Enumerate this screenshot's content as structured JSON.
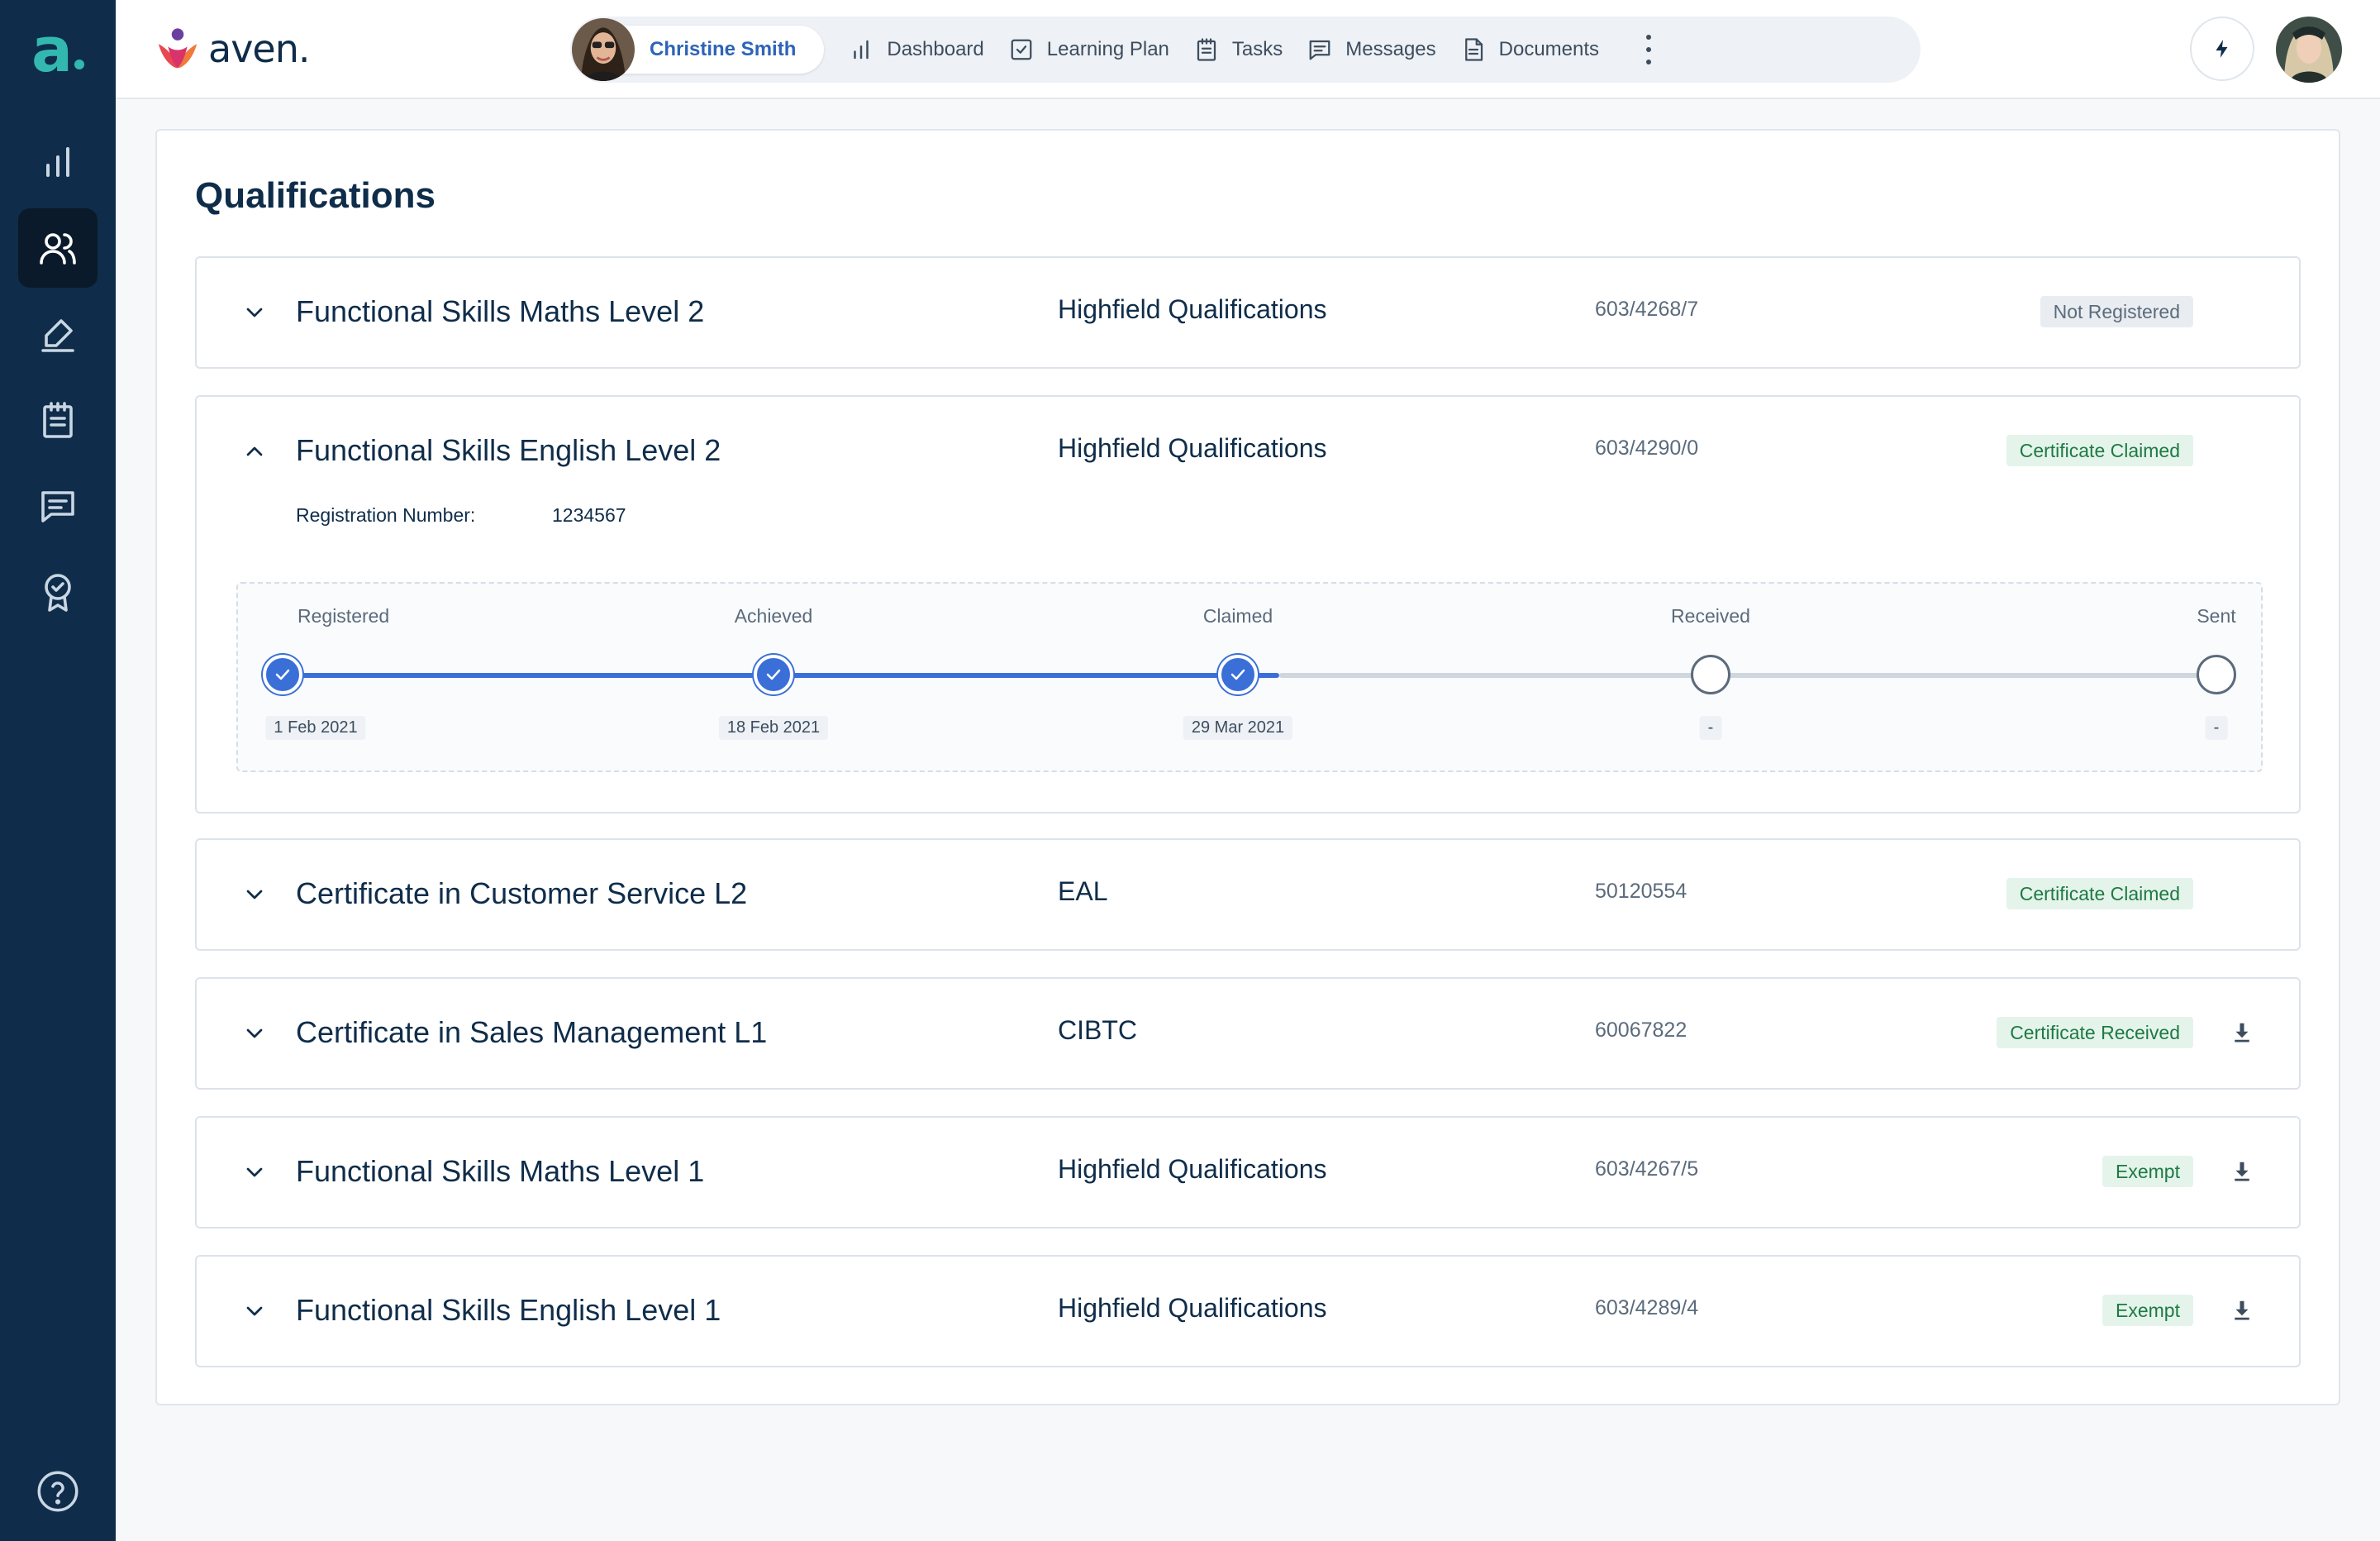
{
  "brand": {
    "name": "aven.",
    "sidebar_logo": "a"
  },
  "sidebar": {
    "items": [
      {
        "icon": "bar-chart-icon",
        "active": false
      },
      {
        "icon": "users-icon",
        "active": true
      },
      {
        "icon": "pen-signature-icon",
        "active": false
      },
      {
        "icon": "clipboard-icon",
        "active": false
      },
      {
        "icon": "chat-icon",
        "active": false
      },
      {
        "icon": "award-icon",
        "active": false
      }
    ],
    "help_icon": "help-circle-icon"
  },
  "header": {
    "user_name": "Christine Smith",
    "nav": [
      {
        "label": "Dashboard",
        "icon": "bar-chart-icon"
      },
      {
        "label": "Learning Plan",
        "icon": "checkbox-icon"
      },
      {
        "label": "Tasks",
        "icon": "clipboard-icon"
      },
      {
        "label": "Messages",
        "icon": "chat-icon"
      },
      {
        "label": "Documents",
        "icon": "document-icon"
      }
    ],
    "more_icon": "more-vertical-icon",
    "action_icon": "lightning-icon"
  },
  "page": {
    "title": "Qualifications",
    "qualifications": [
      {
        "name": "Functional Skills Maths Level 2",
        "org": "Highfield Qualifications",
        "code": "603/4268/7",
        "status": "Not Registered",
        "status_tone": "grey",
        "expanded": false,
        "download": false
      },
      {
        "name": "Functional Skills English Level 2",
        "org": "Highfield Qualifications",
        "code": "603/4290/0",
        "status": "Certificate Claimed",
        "status_tone": "green",
        "expanded": true,
        "download": false
      },
      {
        "name": "Certificate in Customer Service L2",
        "org": "EAL",
        "code": "50120554",
        "status": "Certificate Claimed",
        "status_tone": "green",
        "expanded": false,
        "download": false
      },
      {
        "name": "Certificate in Sales Management L1",
        "org": "CIBTC",
        "code": "60067822",
        "status": "Certificate Received",
        "status_tone": "green",
        "expanded": false,
        "download": true
      },
      {
        "name": "Functional Skills Maths Level 1",
        "org": "Highfield Qualifications",
        "code": "603/4267/5",
        "status": "Exempt",
        "status_tone": "green",
        "expanded": false,
        "download": true
      },
      {
        "name": "Functional Skills English Level 1",
        "org": "Highfield Qualifications",
        "code": "603/4289/4",
        "status": "Exempt",
        "status_tone": "green",
        "expanded": false,
        "download": true
      }
    ],
    "expanded_detail": {
      "registration_label": "Registration Number:",
      "registration_number": "1234567",
      "steps": [
        {
          "label": "Registered",
          "date": "1 Feb 2021",
          "done": true
        },
        {
          "label": "Achieved",
          "date": "18 Feb 2021",
          "done": true
        },
        {
          "label": "Claimed",
          "date": "29 Mar 2021",
          "done": true
        },
        {
          "label": "Received",
          "date": "-",
          "done": false
        },
        {
          "label": "Sent",
          "date": "-",
          "done": false
        }
      ]
    }
  },
  "colors": {
    "sidebar_bg": "#0f2d4a",
    "accent_teal": "#33b8b0",
    "progress_blue": "#3a6fd8",
    "status_green": "#1d7a45"
  }
}
